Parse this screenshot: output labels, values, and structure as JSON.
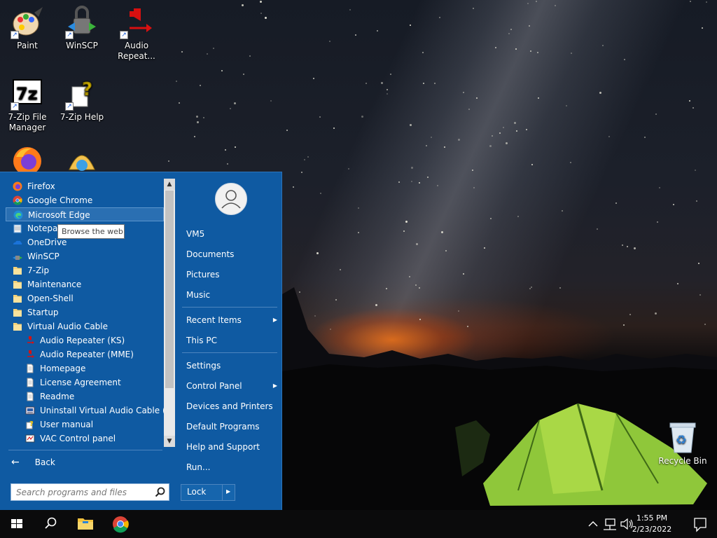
{
  "desktop_icons": [
    {
      "label": "Paint",
      "icon": "paint-palette-icon"
    },
    {
      "label": "WinSCP",
      "icon": "winscp-icon"
    },
    {
      "label": "Audio Repeat...",
      "icon": "audio-repeater-icon"
    },
    {
      "label": "7-Zip File Manager",
      "icon": "7zip-icon"
    },
    {
      "label": "7-Zip Help",
      "icon": "help-document-icon"
    },
    {
      "label": "",
      "icon": "firefox-icon"
    },
    {
      "label": "",
      "icon": "shell-icon"
    }
  ],
  "recycle_bin": {
    "label": "Recycle Bin"
  },
  "start_menu": {
    "programs": [
      {
        "label": "Firefox",
        "icon": "firefox-icon",
        "indent": 0
      },
      {
        "label": "Google Chrome",
        "icon": "chrome-icon",
        "indent": 0
      },
      {
        "label": "Microsoft Edge",
        "icon": "edge-icon",
        "indent": 0,
        "highlighted": true
      },
      {
        "label": "Notepad",
        "icon": "notepad-icon",
        "indent": 0
      },
      {
        "label": "OneDrive",
        "icon": "onedrive-icon",
        "indent": 0
      },
      {
        "label": "WinSCP",
        "icon": "winscp-icon",
        "indent": 0
      },
      {
        "label": "7-Zip",
        "icon": "folder-icon",
        "indent": 0
      },
      {
        "label": "Maintenance",
        "icon": "folder-icon",
        "indent": 0
      },
      {
        "label": "Open-Shell",
        "icon": "folder-icon",
        "indent": 0
      },
      {
        "label": "Startup",
        "icon": "folder-icon",
        "indent": 0
      },
      {
        "label": "Virtual Audio Cable",
        "icon": "folder-icon",
        "indent": 0
      },
      {
        "label": "Audio Repeater (KS)",
        "icon": "audio-repeater-icon",
        "indent": 1
      },
      {
        "label": "Audio Repeater (MME)",
        "icon": "audio-repeater-icon",
        "indent": 1
      },
      {
        "label": "Homepage",
        "icon": "document-icon",
        "indent": 1
      },
      {
        "label": "License Agreement",
        "icon": "document-icon",
        "indent": 1
      },
      {
        "label": "Readme",
        "icon": "document-icon",
        "indent": 1
      },
      {
        "label": "Uninstall Virtual Audio Cable (trial)",
        "icon": "uninstall-icon",
        "indent": 1
      },
      {
        "label": "User manual",
        "icon": "help-document-icon",
        "indent": 1
      },
      {
        "label": "VAC Control panel",
        "icon": "control-panel-icon",
        "indent": 1
      }
    ],
    "tooltip": "Browse the web",
    "back_label": "Back",
    "search_placeholder": "Search programs and files",
    "right_items": [
      {
        "label": "VM5",
        "submenu": false
      },
      {
        "label": "Documents",
        "submenu": false
      },
      {
        "label": "Pictures",
        "submenu": false
      },
      {
        "label": "Music",
        "submenu": false
      },
      {
        "label": "Recent Items",
        "submenu": true
      },
      {
        "label": "This PC",
        "submenu": false
      },
      {
        "label": "Settings",
        "submenu": false
      },
      {
        "label": "Control Panel",
        "submenu": true
      },
      {
        "label": "Devices and Printers",
        "submenu": false
      },
      {
        "label": "Default Programs",
        "submenu": false
      },
      {
        "label": "Help and Support",
        "submenu": false
      },
      {
        "label": "Run...",
        "submenu": false
      }
    ],
    "lock_label": "Lock"
  },
  "taskbar": {
    "pinned": [
      "start-icon",
      "search-icon",
      "file-explorer-icon",
      "chrome-icon"
    ],
    "clock_time": "1:55 PM",
    "clock_date": "2/23/2022"
  }
}
